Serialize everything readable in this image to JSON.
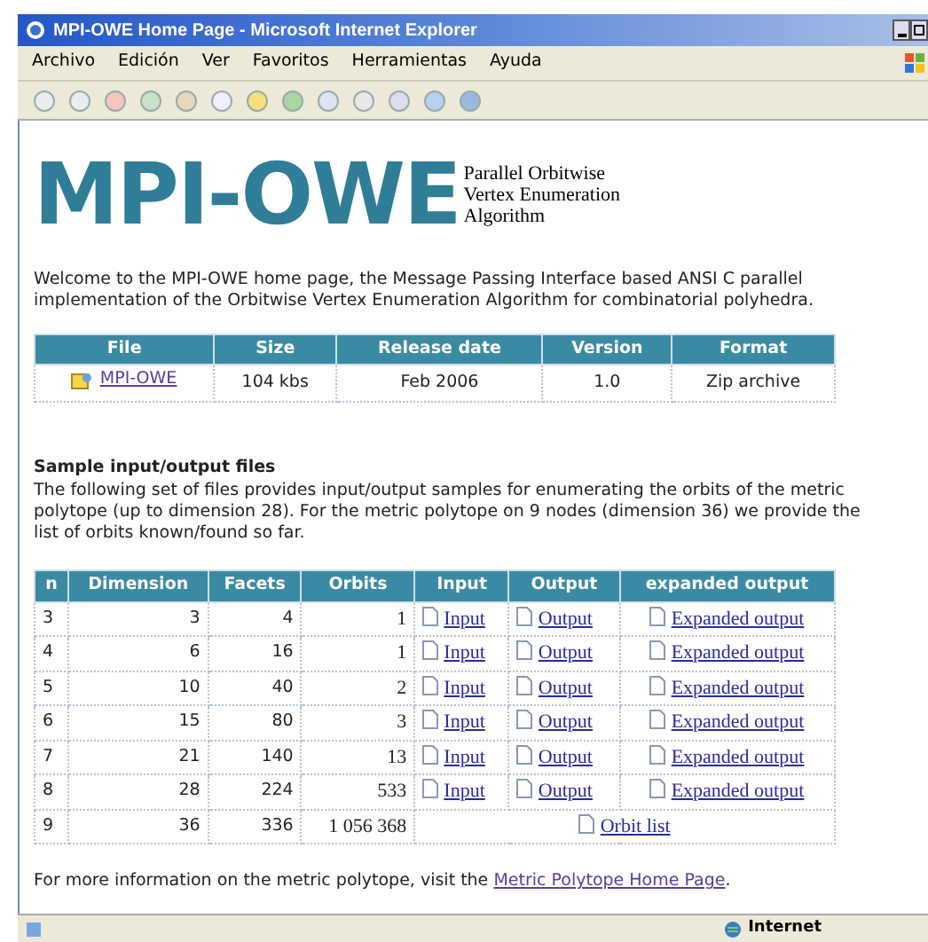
{
  "window": {
    "title": "MPI-OWE Home Page - Microsoft Internet Explorer"
  },
  "menu": [
    "Archivo",
    "Edición",
    "Ver",
    "Favoritos",
    "Herramientas",
    "Ayuda"
  ],
  "logo": {
    "mark": "MPI-OWE",
    "tagline": [
      "Parallel Orbitwise",
      "Vertex Enumeration",
      "Algorithm"
    ]
  },
  "intro": "Welcome to the MPI-OWE home page, the Message Passing Interface based ANSI C parallel implementation of the Orbitwise Vertex Enumeration Algorithm for combinatorial polyhedra.",
  "file_table": {
    "columns": [
      "File",
      "Size",
      "Release date",
      "Version",
      "Format"
    ],
    "rows": [
      {
        "file": "MPI-OWE",
        "size": "104 kbs",
        "date": "Feb 2006",
        "version": "1.0",
        "format": "Zip archive"
      }
    ]
  },
  "samples": {
    "heading": "Sample input/output files",
    "text": "The following set of files provides input/output samples for enumerating the orbits of the metric polytope (up to dimension 28). For the metric polytope on 9 nodes (dimension 36) we provide the list of orbits known/found so far.",
    "columns": [
      "n",
      "Dimension",
      "Facets",
      "Orbits",
      "Input",
      "Output",
      "expanded output"
    ],
    "rows": [
      {
        "kind": "files",
        "n": "3",
        "dimension": "3",
        "facets": "4",
        "orbits": "1",
        "links": [
          "Input",
          "Output",
          "Expanded output"
        ]
      },
      {
        "kind": "files",
        "n": "4",
        "dimension": "6",
        "facets": "16",
        "orbits": "1",
        "links": [
          "Input",
          "Output",
          "Expanded output"
        ]
      },
      {
        "kind": "files",
        "n": "5",
        "dimension": "10",
        "facets": "40",
        "orbits": "2",
        "links": [
          "Input",
          "Output",
          "Expanded output"
        ]
      },
      {
        "kind": "files",
        "n": "6",
        "dimension": "15",
        "facets": "80",
        "orbits": "3",
        "links": [
          "Input",
          "Output",
          "Expanded output"
        ]
      },
      {
        "kind": "files",
        "n": "7",
        "dimension": "21",
        "facets": "140",
        "orbits": "13",
        "links": [
          "Input",
          "Output",
          "Expanded output"
        ]
      },
      {
        "kind": "files",
        "n": "8",
        "dimension": "28",
        "facets": "224",
        "orbits": "533",
        "links": [
          "Input",
          "Output",
          "Expanded output"
        ]
      },
      {
        "kind": "orbit_list",
        "n": "9",
        "dimension": "36",
        "facets": "336",
        "orbits": "1 056 368",
        "links": [
          "Orbit list"
        ]
      }
    ]
  },
  "footer": {
    "text": "For more information on the metric polytope, visit the",
    "link": "Metric Polytope Home Page",
    "end": "."
  },
  "status_bar": {
    "zone": "Internet"
  }
}
